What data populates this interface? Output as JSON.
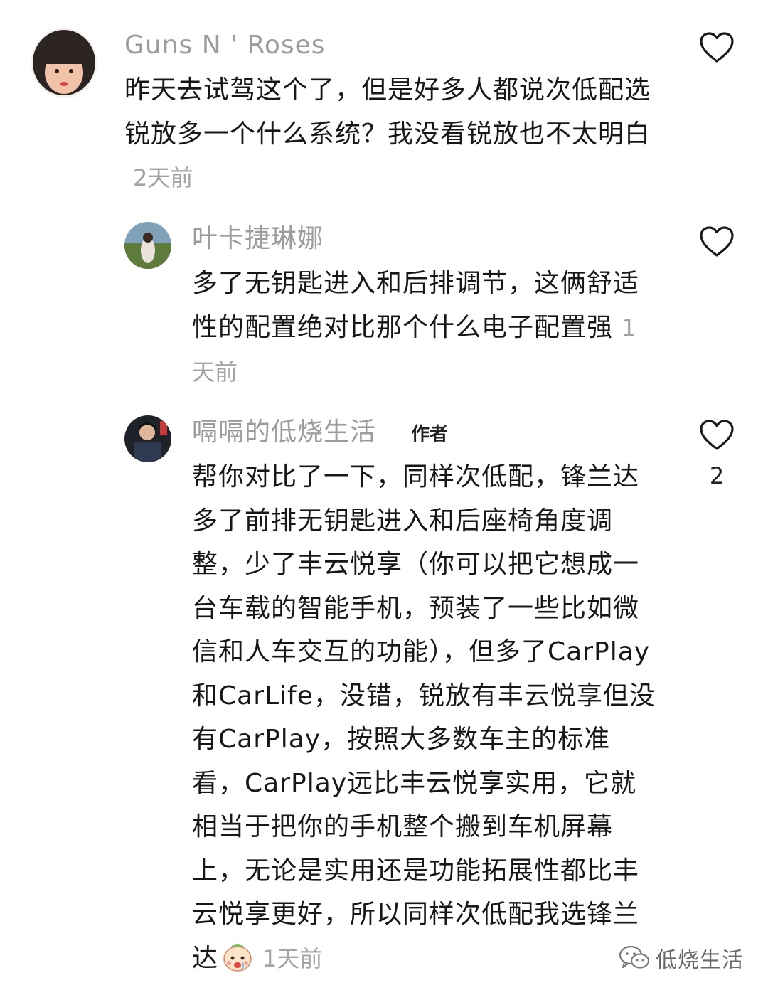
{
  "comments": [
    {
      "username": "Guns N ' Roses",
      "text": "昨天去试驾这个了，但是好多人都说次低配选锐放多一个什么系统？我没看锐放也不太明白",
      "time": "2天前"
    },
    {
      "username": "叶卡捷琳娜",
      "text": "多了无钥匙进入和后排调节，这俩舒适性的配置绝对比那个什么电子配置强",
      "time": "1天前"
    },
    {
      "username": "嗝嗝的低烧生活",
      "badge": "作者",
      "text": "帮你对比了一下，同样次低配，锋兰达多了前排无钥匙进入和后座椅角度调整，少了丰云悦享（你可以把它想成一台车载的智能手机，预装了一些比如微信和人车交互的功能），但多了CarPlay和CarLife，没错，锐放有丰云悦享但没有CarPlay，按照大多数车主的标准看，CarPlay远比丰云悦享实用，它就相当于把你的手机整个搬到车机屏幕上，无论是实用还是功能拓展性都比丰云悦享更好，所以同样次低配我选锋兰达",
      "time": "1天前",
      "likes": "2"
    }
  ],
  "watermark": "低烧生活",
  "icons": {
    "like": "heart-outline-icon",
    "emoji": "crying-face-emoji",
    "watermark": "wechat-icon"
  }
}
